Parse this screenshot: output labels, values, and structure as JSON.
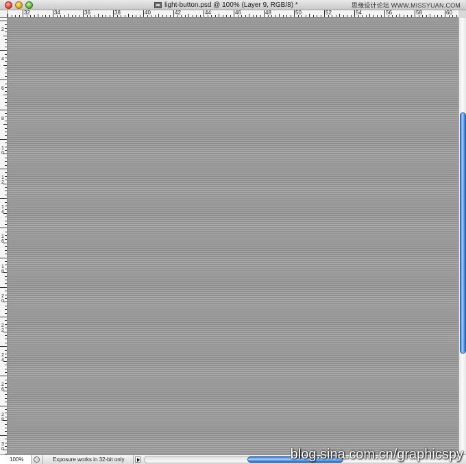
{
  "window": {
    "title": "light-button.psd @ 100% (Layer 9, RGB/8) *"
  },
  "watermarks": {
    "top_right": "思缘设计论坛 WWW.MISSYUAN.COM",
    "bottom_right": "blog.sina.com.cn/graphicspy"
  },
  "ruler": {
    "top_labels": [
      "32",
      "34",
      "36",
      "38",
      "40",
      "42",
      "44",
      "46",
      "48",
      "50",
      "52",
      "54",
      "56",
      "58",
      "60"
    ],
    "left_labels": [
      "2",
      "4",
      "6",
      "8",
      "10",
      "12",
      "14",
      "16",
      "18",
      "20",
      "22",
      "24",
      "26",
      "28",
      "30"
    ]
  },
  "status": {
    "zoom": "100%",
    "message": "Exposure works in 32-bit only"
  },
  "colors": {
    "scroll_thumb": "#5a9ae9",
    "canvas": "#999999"
  },
  "icons": {
    "close": "close-icon",
    "minimize": "minimize-icon",
    "maximize": "maximize-icon",
    "document": "psd-document-icon",
    "status": "status-info-icon",
    "arrow": "play-arrow-icon"
  }
}
